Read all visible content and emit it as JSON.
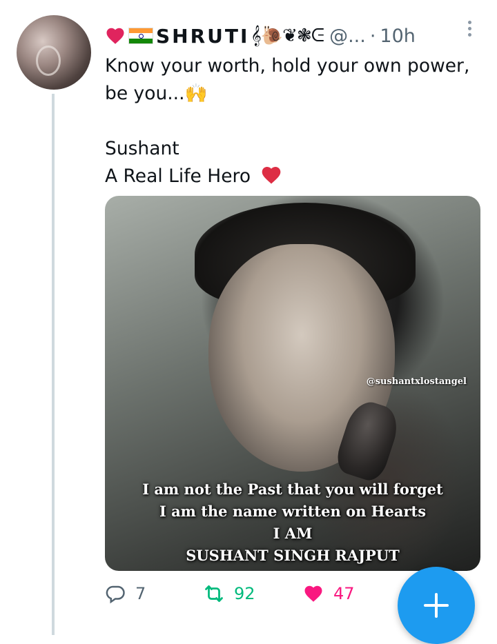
{
  "tweet": {
    "display_name": "SHRUTI",
    "name_decoration": "𝄞🐌❦❃ᕮ",
    "handle": "@...",
    "separator": "·",
    "time": "10h",
    "lines": [
      "Know your worth, hold your own power,",
      "be you...🙌",
      "",
      "Sushant",
      "A Real Life Hero"
    ],
    "media": {
      "watermark": "@sushantxlostangel",
      "caption": [
        "I am not the Past that you will forget",
        "I am the name written on Hearts",
        "I AM",
        "SUSHANT SINGH RAJPUT"
      ]
    },
    "actions": {
      "reply_count": "7",
      "retweet_count": "92",
      "like_count": "47"
    }
  },
  "colors": {
    "accent": "#1d9bf0",
    "retweet": "#00ba7c",
    "like": "#f91880",
    "muted": "#536471",
    "heart": "#e0245e"
  },
  "icons": [
    "heart-icon",
    "india-flag-icon",
    "more-icon",
    "red-heart-icon",
    "reply-icon",
    "retweet-icon",
    "like-icon",
    "compose-plus-icon"
  ]
}
